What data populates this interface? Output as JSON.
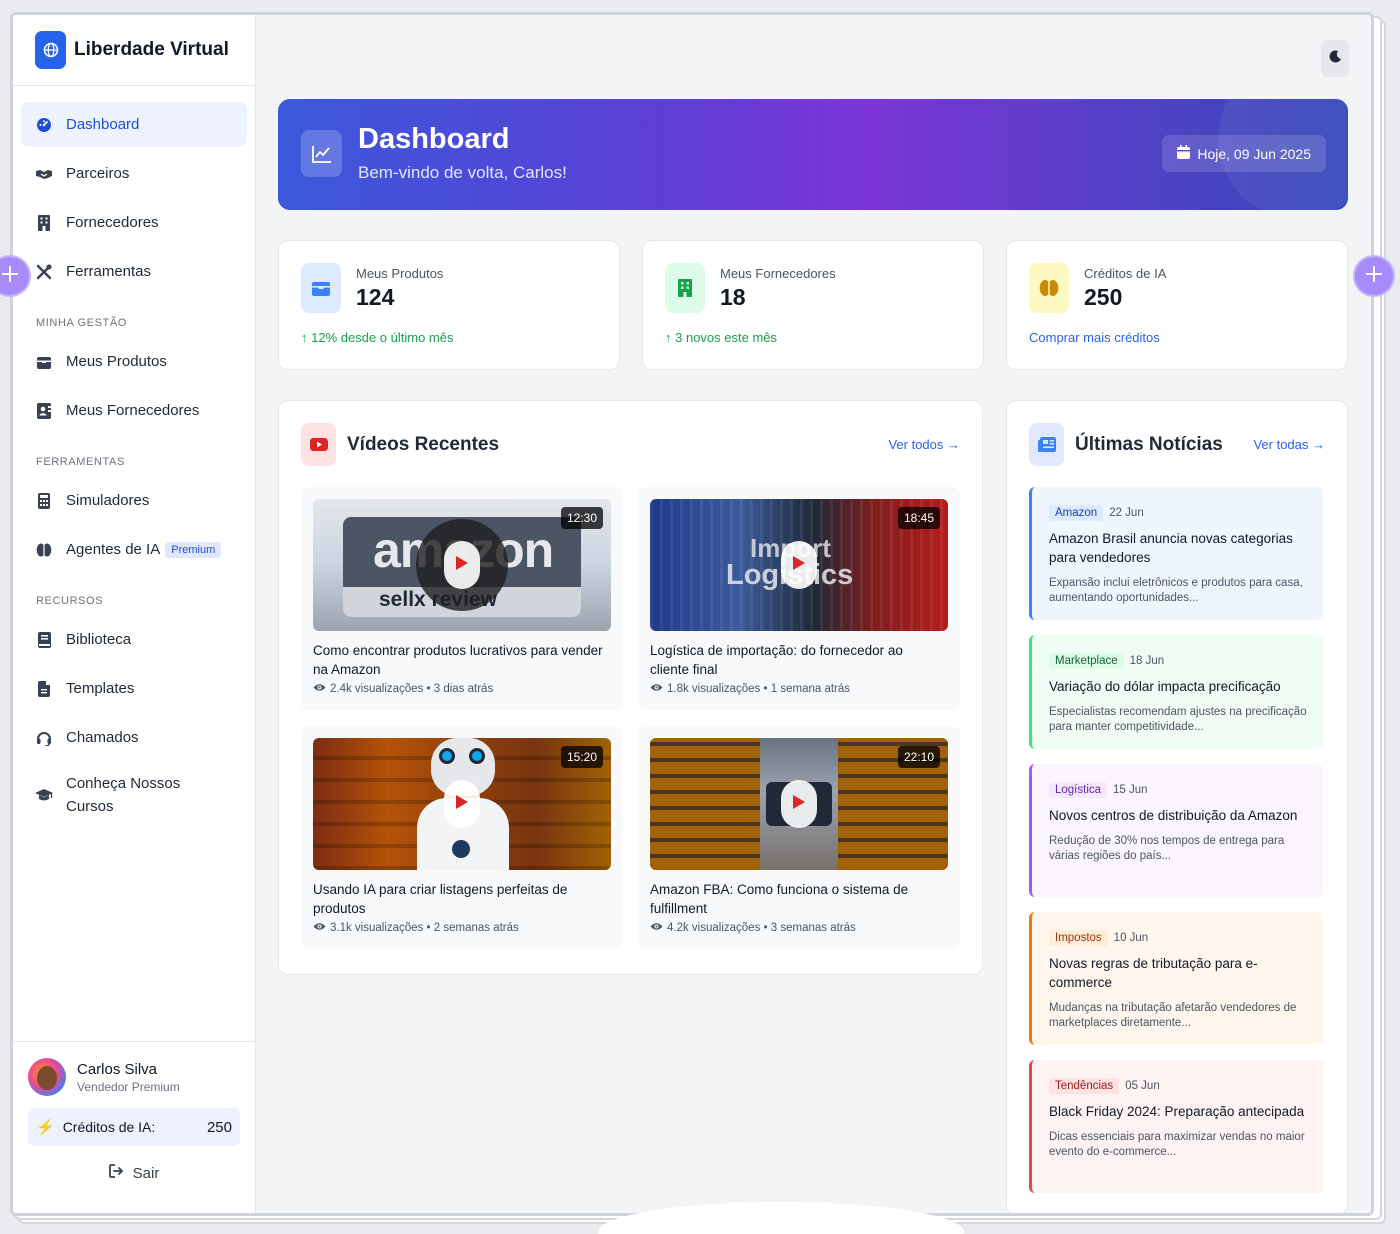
{
  "brand": {
    "name": "Liberdade Virtual"
  },
  "sidebar": {
    "main_items": [
      {
        "label": "Dashboard",
        "icon": "dashboard-icon",
        "active": true
      },
      {
        "label": "Parceiros",
        "icon": "handshake-icon"
      },
      {
        "label": "Fornecedores",
        "icon": "building-icon"
      },
      {
        "label": "Ferramentas",
        "icon": "tools-icon"
      }
    ],
    "sections": [
      {
        "title": "MINHA GESTÃO",
        "items": [
          {
            "label": "Meus Produtos",
            "icon": "box-icon"
          },
          {
            "label": "Meus Fornecedores",
            "icon": "contact-card-icon"
          }
        ]
      },
      {
        "title": "FERRAMENTAS",
        "items": [
          {
            "label": "Simuladores",
            "icon": "calculator-icon"
          },
          {
            "label": "Agentes de IA",
            "icon": "brain-icon",
            "badge": "Premium"
          }
        ]
      },
      {
        "title": "RECURSOS",
        "items": [
          {
            "label": "Biblioteca",
            "icon": "book-icon"
          },
          {
            "label": "Templates",
            "icon": "file-icon"
          },
          {
            "label": "Chamados",
            "icon": "headset-icon"
          },
          {
            "label": "Conheça Nossos Cursos",
            "icon": "graduation-cap-icon"
          }
        ]
      }
    ],
    "user": {
      "name": "Carlos Silva",
      "role": "Vendedor Premium"
    },
    "credits": {
      "label": "Créditos de IA:",
      "value": "250"
    },
    "logout_label": "Sair"
  },
  "hero": {
    "title": "Dashboard",
    "subtitle": "Bem-vindo de volta, Carlos!",
    "date": "Hoje, 09 Jun 2025"
  },
  "stats": [
    {
      "label": "Meus Produtos",
      "value": "124",
      "note": "12% desde o último mês",
      "icon": "box-icon",
      "color": "#3b82f6",
      "bg": "#dbeafe"
    },
    {
      "label": "Meus Fornecedores",
      "value": "18",
      "note": "3 novos este mês",
      "icon": "building-icon",
      "color": "#16a34a",
      "bg": "#dcfce7"
    },
    {
      "label": "Créditos de IA",
      "value": "250",
      "note": "Comprar mais créditos",
      "icon": "brain-icon",
      "color": "#ca8a04",
      "bg": "#fef9c3"
    }
  ],
  "videos": {
    "title": "Vídeos Recentes",
    "link": "Ver todos →",
    "items": [
      {
        "title": "Como encontrar produtos lucrativos para vender na Amazon",
        "duration": "12:30",
        "views": "2.4k visualizações",
        "ago": "3 dias atrás",
        "thumb_text_1": "amazon",
        "thumb_text_2": "sellx review"
      },
      {
        "title": "Logística de importação: do fornecedor ao cliente final",
        "duration": "18:45",
        "views": "1.8k visualizações",
        "ago": "1 semana atrás",
        "thumb_text_1": "Import",
        "thumb_text_2": "Logistics"
      },
      {
        "title": "Usando IA para criar listagens perfeitas de produtos",
        "duration": "15:20",
        "views": "3.1k visualizações",
        "ago": "2 semanas atrás"
      },
      {
        "title": "Amazon FBA: Como funciona o sistema de fulfillment",
        "duration": "22:10",
        "views": "4.2k visualizações",
        "ago": "3 semanas atrás"
      }
    ]
  },
  "news": {
    "title": "Últimas Notícias",
    "link": "Ver todas →",
    "items": [
      {
        "tag": "Amazon",
        "date": "22 Jun",
        "title": "Amazon Brasil anuncia novas categorias para vendedores",
        "desc": "Expansão inclui eletrônicos e produtos para casa, aumentando oportunidades...",
        "accent": "#3b82f6",
        "bg": "#eff6ff",
        "tag_bg": "#dbeafe",
        "tag_color": "#1e40af"
      },
      {
        "tag": "Marketplace",
        "date": "18 Jun",
        "title": "Variação do dólar impacta precificação",
        "desc": "Especialistas recomendam ajustes na precificação para manter competitividade...",
        "accent": "#4ade80",
        "bg": "#f0fdf4",
        "tag_bg": "#dcfce7",
        "tag_color": "#166534"
      },
      {
        "tag": "Logística",
        "date": "15 Jun",
        "title": "Novos centros de distribuição da Amazon",
        "desc": "Redução de 30% nos tempos de entrega para várias regiões do país...",
        "accent": "#a855f7",
        "bg": "#faf5ff",
        "tag_bg": "#f3e8ff",
        "tag_color": "#6b21a8"
      },
      {
        "tag": "Impostos",
        "date": "10 Jun",
        "title": "Novas regras de tributação para e-commerce",
        "desc": "Mudanças na tributação afetarão vendedores de marketplaces diretamente...",
        "accent": "#f97316",
        "bg": "#fff7ed",
        "tag_bg": "#ffedd5",
        "tag_color": "#9a3412"
      },
      {
        "tag": "Tendências",
        "date": "05 Jun",
        "title": "Black Friday 2024: Preparação antecipada",
        "desc": "Dicas essenciais para maximizar vendas no maior evento do e-commerce...",
        "accent": "#ef4444",
        "bg": "#fef2f2",
        "tag_bg": "#fee2e2",
        "tag_color": "#991b1b"
      }
    ]
  }
}
